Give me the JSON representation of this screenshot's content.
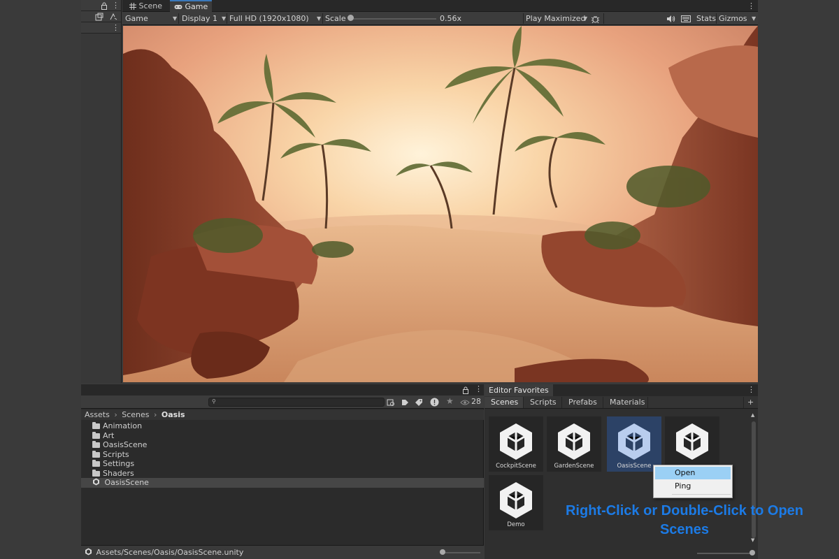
{
  "colors": {
    "accent": "#3a79bb",
    "selection": "#2c4266",
    "caption": "#1c7be6",
    "menu_highlight": "#9bd0f5"
  },
  "game_window": {
    "tabs": [
      {
        "label": "Scene",
        "icon": "grid-icon"
      },
      {
        "label": "Game",
        "icon": "gamepad-icon",
        "active": true
      }
    ],
    "toolbar": {
      "view_mode": "Game",
      "display": "Display 1",
      "resolution": "Full HD (1920x1080)",
      "scale_label": "Scale",
      "scale_value": "0.56x",
      "play_mode": "Play Maximized",
      "stats": "Stats",
      "gizmos": "Gizmos"
    }
  },
  "project": {
    "item_count": "28",
    "search_value": "",
    "breadcrumb": [
      "Assets",
      "Scenes",
      "Oasis"
    ],
    "tree": [
      {
        "label": "Animation",
        "type": "folder"
      },
      {
        "label": "Art",
        "type": "folder"
      },
      {
        "label": "OasisScene",
        "type": "folder"
      },
      {
        "label": "Scripts",
        "type": "folder"
      },
      {
        "label": "Settings",
        "type": "folder"
      },
      {
        "label": "Shaders",
        "type": "folder"
      },
      {
        "label": "OasisScene",
        "type": "scene",
        "selected": true
      }
    ],
    "status_path": "Assets/Scenes/Oasis/OasisScene.unity"
  },
  "favorites": {
    "title": "Editor Favorites",
    "tabs": [
      "Scenes",
      "Scripts",
      "Prefabs",
      "Materials"
    ],
    "add_label": "+",
    "scenes": [
      {
        "label": "CockpitScene"
      },
      {
        "label": "GardenScene"
      },
      {
        "label": "OasisScene",
        "selected": true
      },
      {
        "label": ""
      },
      {
        "label": "Demo"
      }
    ],
    "context_menu": [
      "Open",
      "Ping"
    ]
  },
  "caption": {
    "line1": "Right-Click or Double-Click to Open",
    "line2": "Scenes"
  }
}
